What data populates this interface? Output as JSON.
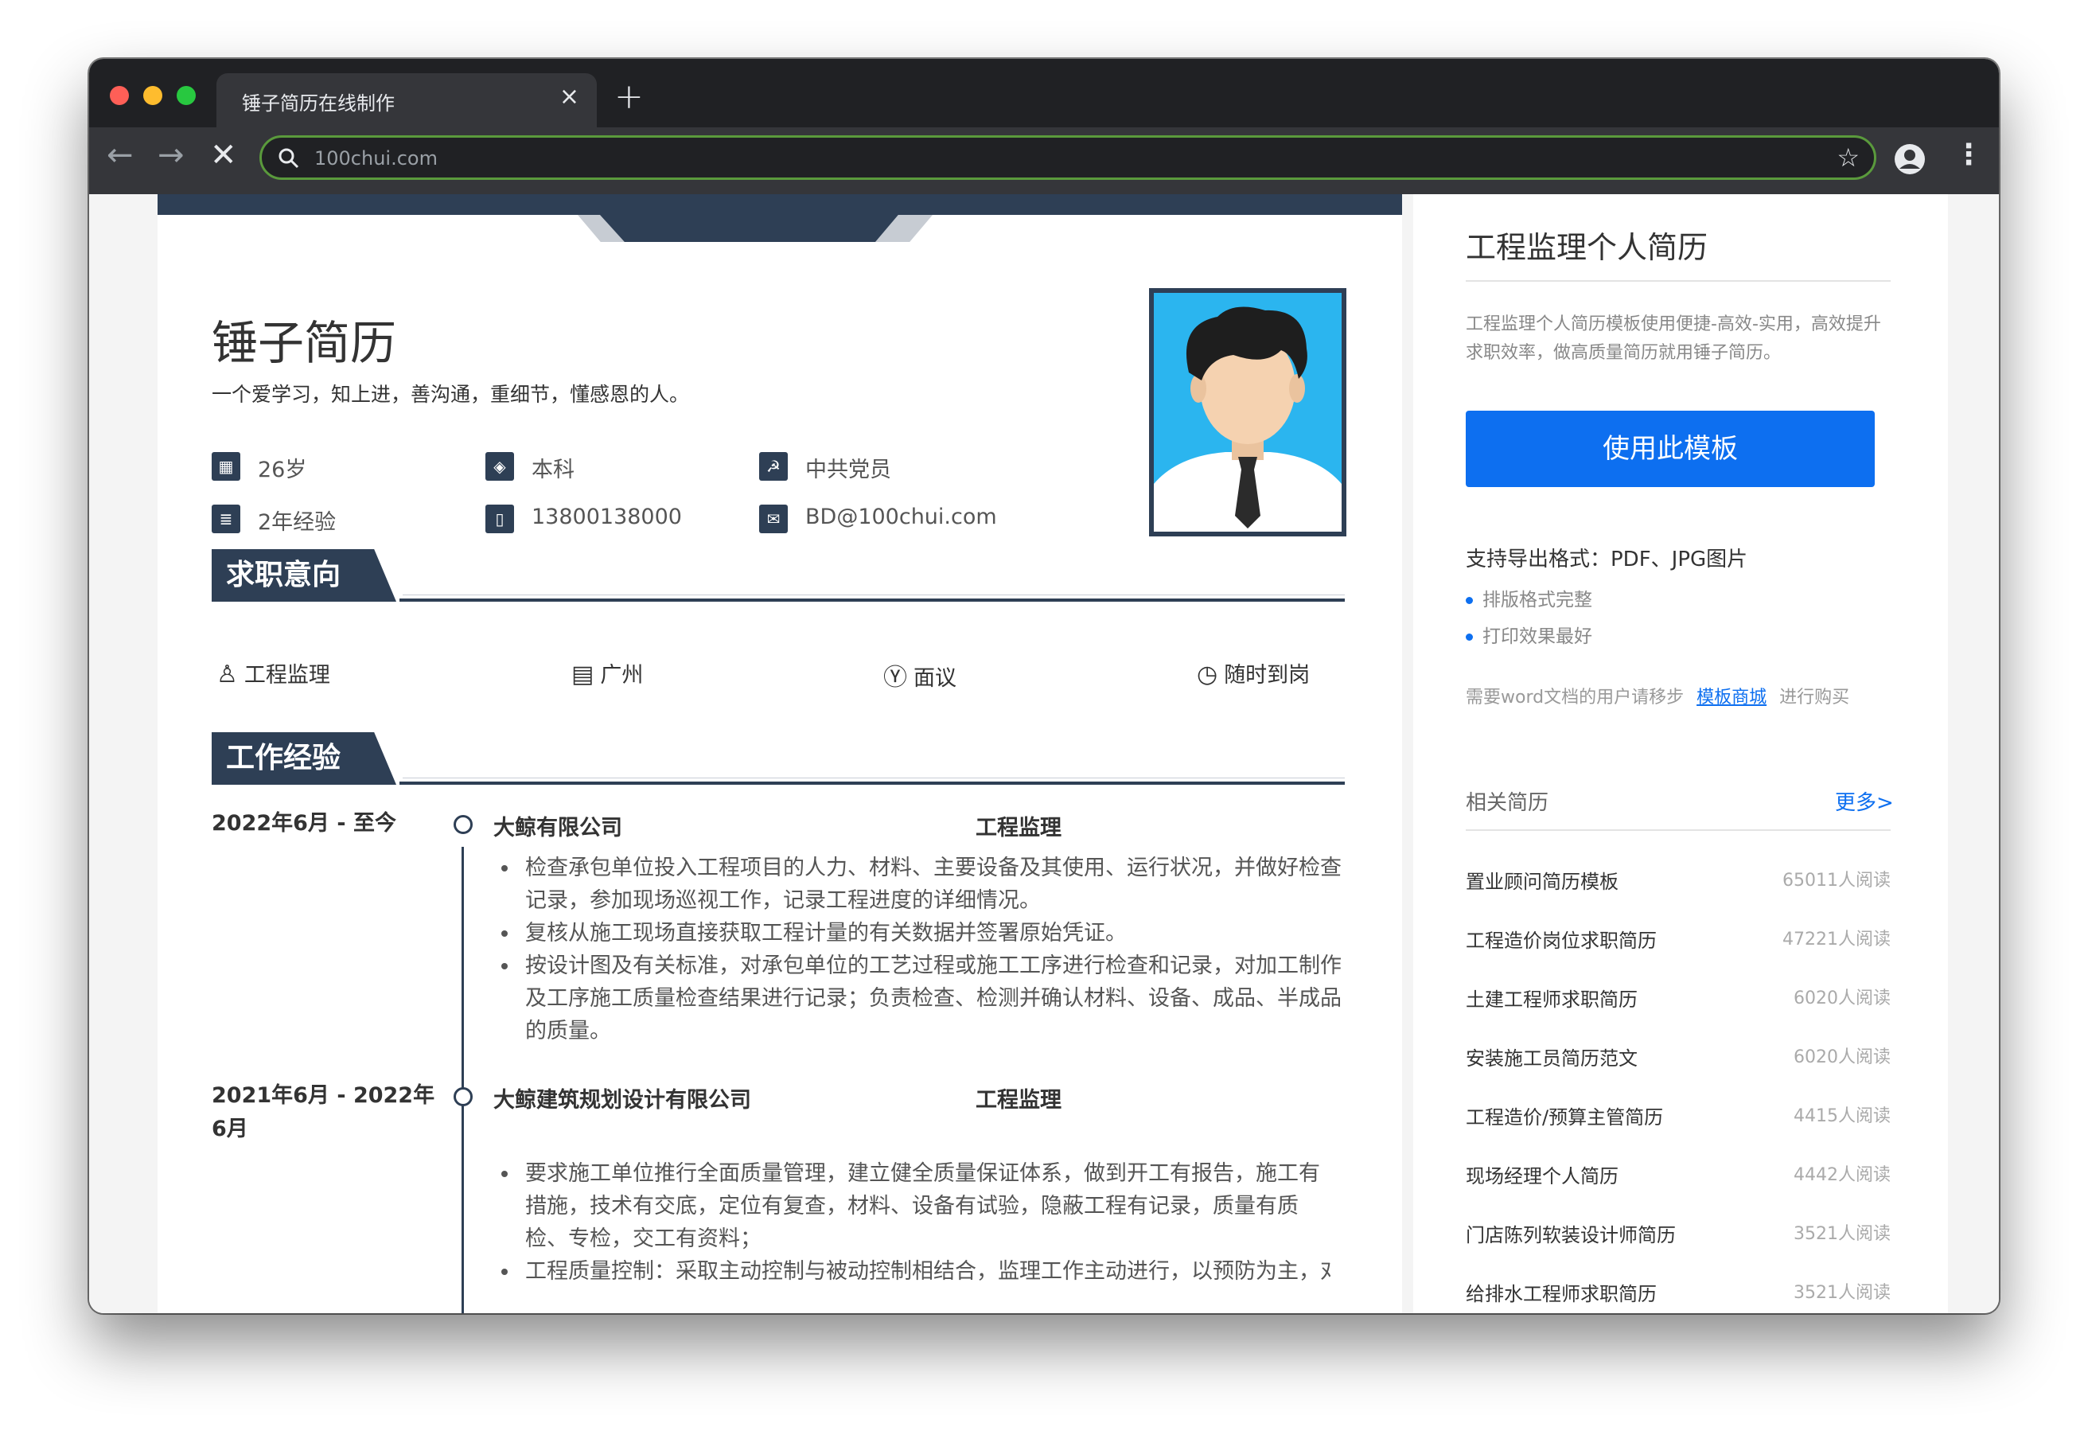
{
  "browser": {
    "tab_title": "锤子简历在线制作",
    "tab_close": "×",
    "new_tab": "+",
    "url": "100chui.com",
    "colors": {
      "traffic_red": "#ff5f57",
      "traffic_yellow": "#febc2e",
      "traffic_green": "#28c840"
    }
  },
  "resume": {
    "name": "锤子简历",
    "motto": "一个爱学习，知上进，善沟通，重细节，懂感恩的人。",
    "info": {
      "age": "26岁",
      "education": "本科",
      "politics": "中共党员",
      "experience": "2年经验",
      "phone": "13800138000",
      "email": "BD@100chui.com"
    },
    "intent_section": {
      "title": "求职意向",
      "position": "工程监理",
      "city": "广州",
      "salary": "面议",
      "availability": "随时到岗"
    },
    "work_section": {
      "title": "工作经验",
      "jobs": [
        {
          "date": "2022年6月 - 至今",
          "company": "大鲸有限公司",
          "role": "工程监理",
          "duties": [
            "检查承包单位投入工程项目的人力、材料、主要设备及其使用、运行状况，并做好检查记录，参加现场巡视工作，记录工程进度的详细情况。",
            "复核从施工现场直接获取工程计量的有关数据并签署原始凭证。",
            "按设计图及有关标准，对承包单位的工艺过程或施工工序进行检查和记录，对加工制作及工序施工质量检查结果进行记录；负责检查、检测并确认材料、设备、成品、半成品的质量。"
          ]
        },
        {
          "date": "2021年6月 - 2022年6月",
          "company": "大鲸建筑规划设计有限公司",
          "role": "工程监理",
          "duties": [
            "要求施工单位推行全面质量管理，建立健全质量保证体系，做到开工有报告，施工有措施，技术有交底，定位有复查，材料、设备有试验，隐蔽工程有记录，质量有质检、专检，交工有资料；",
            "工程质量控制：采取主动控制与被动控制相结合，监理工作主动进行，以预防为主，对承"
          ]
        }
      ]
    }
  },
  "sidebar": {
    "title": "工程监理个人简历",
    "description": "工程监理个人简历模板使用便捷-高效-实用，高效提升求职效率，做高质量简历就用锤子简历。",
    "use_button": "使用此模板",
    "export_formats": "支持导出格式：PDF、JPG图片",
    "bullets": [
      "排版格式完整",
      "打印效果最好"
    ],
    "word_note_prefix": "需要word文档的用户请移步",
    "word_note_link": "模板商城",
    "word_note_suffix": "进行购买",
    "related_title": "相关简历",
    "more_link": "更多>",
    "related": [
      {
        "name": "置业顾问简历模板",
        "count": "65011人阅读"
      },
      {
        "name": "工程造价岗位求职简历",
        "count": "47221人阅读"
      },
      {
        "name": "土建工程师求职简历",
        "count": "6020人阅读"
      },
      {
        "name": "安装施工员简历范文",
        "count": "6020人阅读"
      },
      {
        "name": "工程造价/预算主管简历",
        "count": "4415人阅读"
      },
      {
        "name": "现场经理个人简历",
        "count": "4442人阅读"
      },
      {
        "name": "门店陈列软装设计师简历",
        "count": "3521人阅读"
      },
      {
        "name": "给排水工程师求职简历",
        "count": "3521人阅读"
      }
    ]
  }
}
